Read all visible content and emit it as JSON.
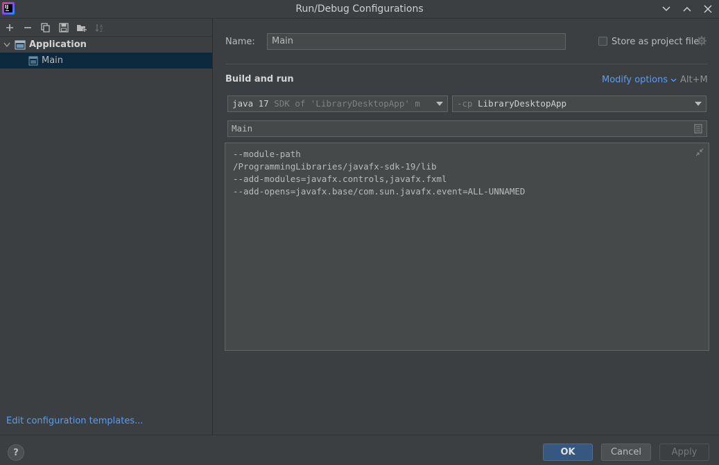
{
  "window": {
    "title": "Run/Debug Configurations"
  },
  "toolbar": {
    "icons": [
      "add-icon",
      "remove-icon",
      "copy-icon",
      "save-icon",
      "new-folder-icon",
      "sort-icon"
    ]
  },
  "tree": {
    "group_label": "Application",
    "item_label": "Main"
  },
  "left_footer": {
    "edit_templates": "Edit configuration templates..."
  },
  "config": {
    "name_label": "Name:",
    "name_value": "Main",
    "store_label": "Store as project file",
    "store_checked": false
  },
  "build_run": {
    "title": "Build and run",
    "modify_options": "Modify options",
    "modify_shortcut": "Alt+M",
    "jdk_strong": "java 17",
    "jdk_dim": "SDK of 'LibraryDesktopApp' m",
    "cp_flag": "-cp",
    "cp_value": "LibraryDesktopApp",
    "main_class": "Main",
    "vm_options": [
      "--module-path",
      "/ProgrammingLibraries/javafx-sdk-19/lib",
      "--add-modules=javafx.controls,javafx.fxml",
      "--add-opens=javafx.base/com.sun.javafx.event=ALL-UNNAMED"
    ]
  },
  "buttons": {
    "help": "?",
    "ok": "OK",
    "cancel": "Cancel",
    "apply": "Apply"
  },
  "colors": {
    "background": "#3c3f41",
    "selection": "#0d293e",
    "link": "#589df6",
    "ok_button": "#365880"
  }
}
